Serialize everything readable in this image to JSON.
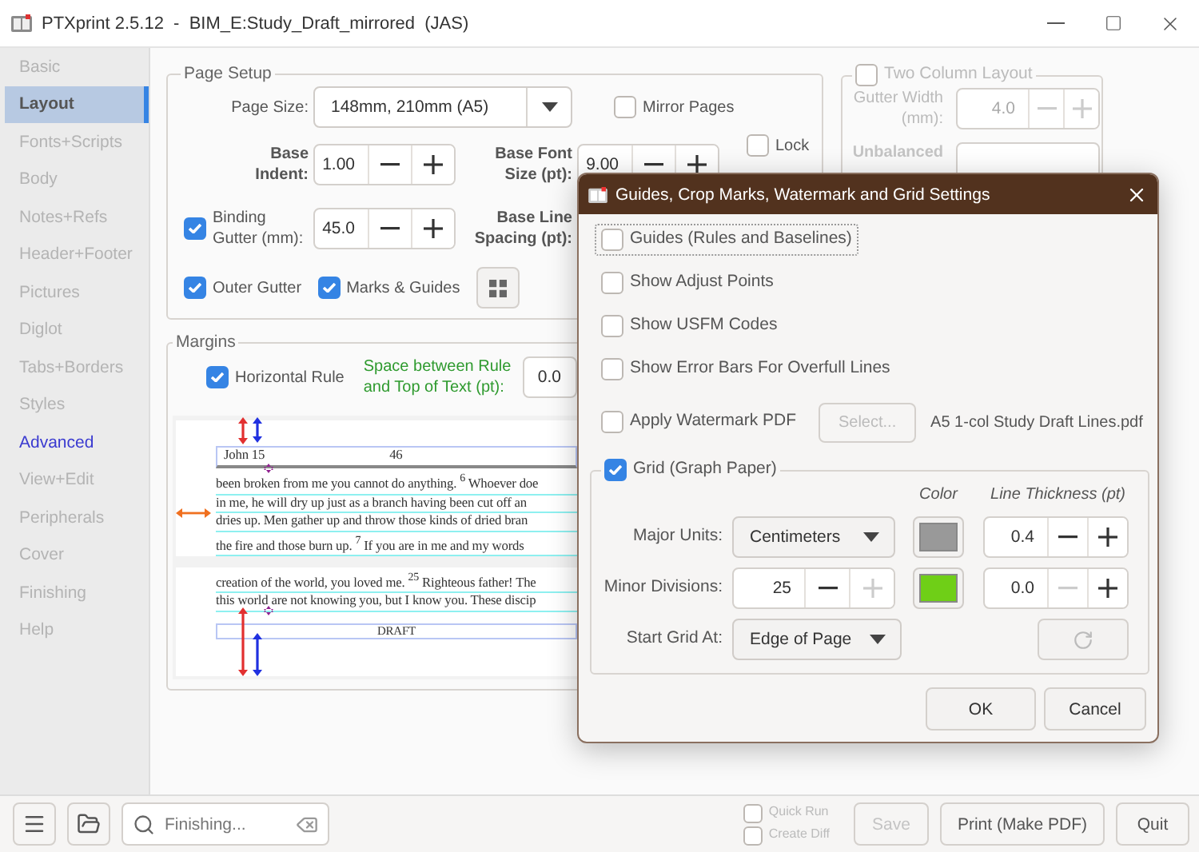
{
  "window": {
    "title": "PTXprint 2.5.12  -  BIM_E:Study_Draft_mirrored  (JAS)"
  },
  "sidebar": {
    "items": [
      {
        "label": "Basic",
        "selected": false,
        "highlighted": false
      },
      {
        "label": "Layout",
        "selected": true,
        "highlighted": false
      },
      {
        "label": "Fonts+Scripts",
        "selected": false,
        "highlighted": false
      },
      {
        "label": "Body",
        "selected": false,
        "highlighted": false
      },
      {
        "label": "Notes+Refs",
        "selected": false,
        "highlighted": false
      },
      {
        "label": "Header+Footer",
        "selected": false,
        "highlighted": false
      },
      {
        "label": "Pictures",
        "selected": false,
        "highlighted": false
      },
      {
        "label": "Diglot",
        "selected": false,
        "highlighted": false
      },
      {
        "label": "Tabs+Borders",
        "selected": false,
        "highlighted": false
      },
      {
        "label": "Styles",
        "selected": false,
        "highlighted": false
      },
      {
        "label": "Advanced",
        "selected": false,
        "highlighted": true
      },
      {
        "label": "View+Edit",
        "selected": false,
        "highlighted": false
      },
      {
        "label": "Peripherals",
        "selected": false,
        "highlighted": false
      },
      {
        "label": "Cover",
        "selected": false,
        "highlighted": false
      },
      {
        "label": "Finishing",
        "selected": false,
        "highlighted": false
      },
      {
        "label": "Help",
        "selected": false,
        "highlighted": false
      }
    ]
  },
  "page_setup": {
    "title": "Page Setup",
    "page_size": {
      "label": "Page Size:",
      "value": "148mm, 210mm (A5)"
    },
    "mirror_pages": {
      "label": "Mirror Pages",
      "checked": false
    },
    "base_indent": {
      "label": "Base Indent:",
      "value": "1.00"
    },
    "base_font_size": {
      "label": "Base Font Size (pt):",
      "value": "9.00"
    },
    "lock": {
      "label": "Lock",
      "checked": false
    },
    "binding_gutter": {
      "label": "Binding Gutter (mm):",
      "checked": true,
      "value": "45.0"
    },
    "base_line_spacing": {
      "label": "Base Line Spacing (pt):"
    },
    "outer_gutter": {
      "label": "Outer Gutter",
      "checked": true
    },
    "marks_guides": {
      "label": "Marks & Guides",
      "checked": true
    }
  },
  "two_column": {
    "label": "Two Column Layout",
    "checked": false,
    "gutter_width": {
      "label": "Gutter Width (mm):",
      "value": "4.0",
      "disabled": true
    },
    "unbalanced": {
      "label": "Unbalanced"
    }
  },
  "margins": {
    "title": "Margins",
    "horizontal_rule": {
      "label": "Horizontal Rule",
      "checked": true
    },
    "space_between": {
      "label": "Space between Rule and Top of Text (pt):",
      "value": "0.0"
    },
    "preview": {
      "header_left": "John 15",
      "header_page": "46",
      "lines": [
        "been broken from me you cannot do anything. $^{6}$ Whoever doe",
        "in me, he will dry up just as a branch having been cut off an",
        "dries up. Men gather up and throw those kinds of dried bran",
        "the fire and those burn up. $^{7}$ If you are in me and my words"
      ],
      "lines_2": [
        "creation of the world, you loved me. $^{25}$ Righteous father! The",
        "this world are not knowing you, but I know you. These discip"
      ],
      "footer": "DRAFT"
    }
  },
  "dialog": {
    "title": "Guides, Crop Marks, Watermark and Grid Settings",
    "options": [
      {
        "label": "Guides (Rules and Baselines)",
        "checked": false,
        "focused": true
      },
      {
        "label": "Show Adjust Points",
        "checked": false,
        "focused": false
      },
      {
        "label": "Show USFM Codes",
        "checked": false,
        "focused": false
      },
      {
        "label": "Show Error Bars For Overfull Lines",
        "checked": false,
        "focused": false
      }
    ],
    "watermark": {
      "label": "Apply Watermark PDF",
      "checked": false,
      "button": "Select...",
      "button_disabled": true,
      "file": "A5 1-col Study Draft Lines.pdf"
    },
    "grid": {
      "label": "Grid (Graph Paper)",
      "checked": true,
      "color_header": "Color",
      "thickness_header": "Line Thickness (pt)",
      "major": {
        "label": "Major Units:",
        "value": "Centimeters",
        "color": "#999999",
        "thickness": {
          "value": "0.4",
          "minus_disabled": false,
          "plus_disabled": false
        }
      },
      "minor": {
        "label": "Minor Divisions:",
        "spin": {
          "value": "25",
          "minus_disabled": false,
          "plus_disabled": true
        },
        "color": "#6fcf17",
        "thickness": {
          "value": "0.0",
          "minus_disabled": true,
          "plus_disabled": false
        }
      },
      "start": {
        "label": "Start Grid At:",
        "value": "Edge of Page"
      },
      "reset_disabled": true
    },
    "buttons": [
      "OK",
      "Cancel"
    ]
  },
  "bottom_bar": {
    "search": {
      "placeholder": "Finishing..."
    },
    "quick_run": {
      "label": "Quick Run",
      "checked": false
    },
    "create_diff": {
      "label": "Create Diff",
      "checked": false
    },
    "save": {
      "label": "Save",
      "disabled": true
    },
    "print": {
      "label": "Print (Make PDF)",
      "disabled": false
    },
    "quit": {
      "label": "Quit",
      "disabled": false
    }
  }
}
